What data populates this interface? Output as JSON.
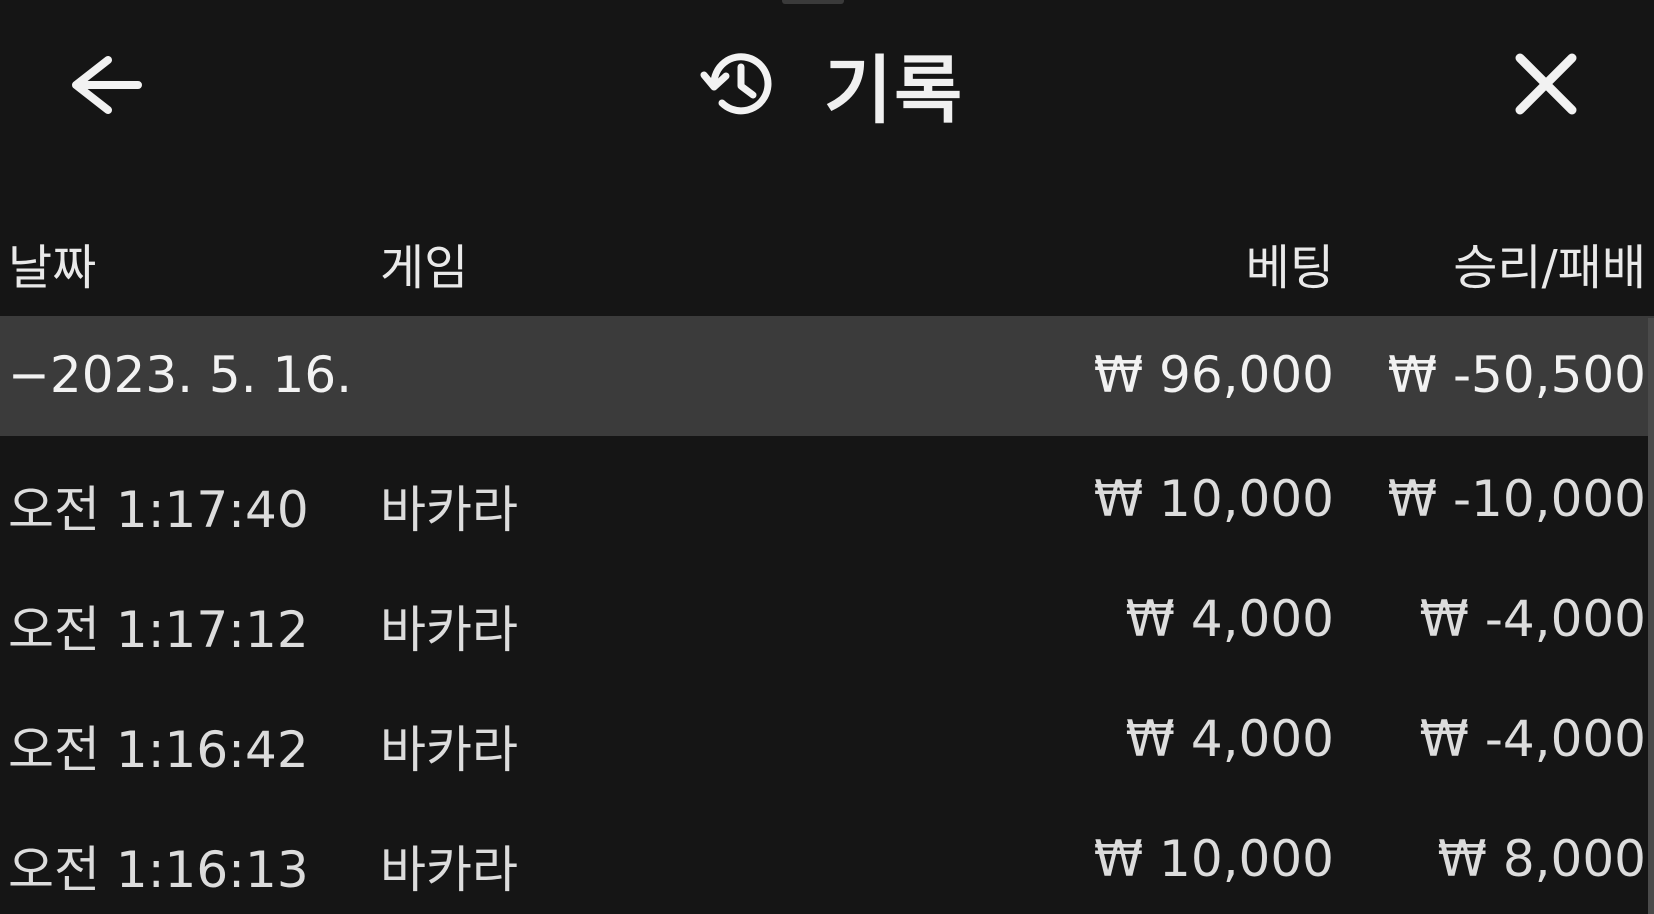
{
  "header": {
    "title": "기록",
    "back_icon": "arrow-left-icon",
    "history_icon": "history-icon",
    "close_icon": "close-icon"
  },
  "table": {
    "columns": {
      "date": "날짜",
      "game": "게임",
      "bet": "베팅",
      "result": "승리/패배"
    },
    "summary": {
      "date": "−2023. 5. 16.",
      "bet": "₩ 96,000",
      "result": "₩ -50,500"
    },
    "rows": [
      {
        "time": "오전 1:17:40",
        "game": "바카라",
        "bet": "₩ 10,000",
        "result": "₩ -10,000"
      },
      {
        "time": "오전 1:17:12",
        "game": "바카라",
        "bet": "₩ 4,000",
        "result": "₩ -4,000"
      },
      {
        "time": "오전 1:16:42",
        "game": "바카라",
        "bet": "₩ 4,000",
        "result": "₩ -4,000"
      },
      {
        "time": "오전 1:16:13",
        "game": "바카라",
        "bet": "₩ 10,000",
        "result": "₩ 8,000"
      }
    ]
  },
  "colors": {
    "background": "#151515",
    "summary_row": "#3b3b3b",
    "text": "#e6e6e6"
  }
}
